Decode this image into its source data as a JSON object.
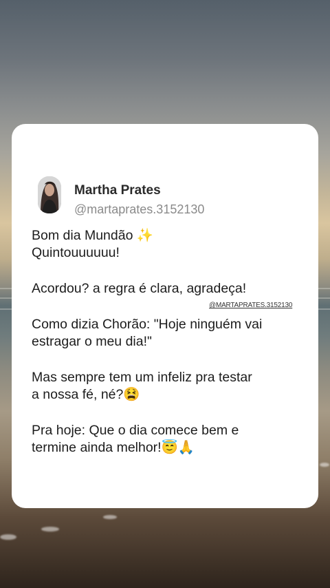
{
  "post": {
    "author_name": "Martha Prates",
    "author_handle": "@martaprates.3152130",
    "watermark": "@MARTAPRATES.3152130",
    "lines": [
      "Bom dia Mundão ✨",
      "Quintouuuuuu!",
      "",
      "Acordou? a regra é clara, agradeça!",
      "",
      "Como dizia Chorão: \"Hoje ninguém vai",
      "estragar o meu dia!\"",
      "",
      "Mas sempre tem um infeliz pra testar",
      "a nossa fé, né?😫",
      "",
      "Pra hoje: Que o dia comece bem e",
      "termine ainda melhor!😇🙏"
    ]
  }
}
